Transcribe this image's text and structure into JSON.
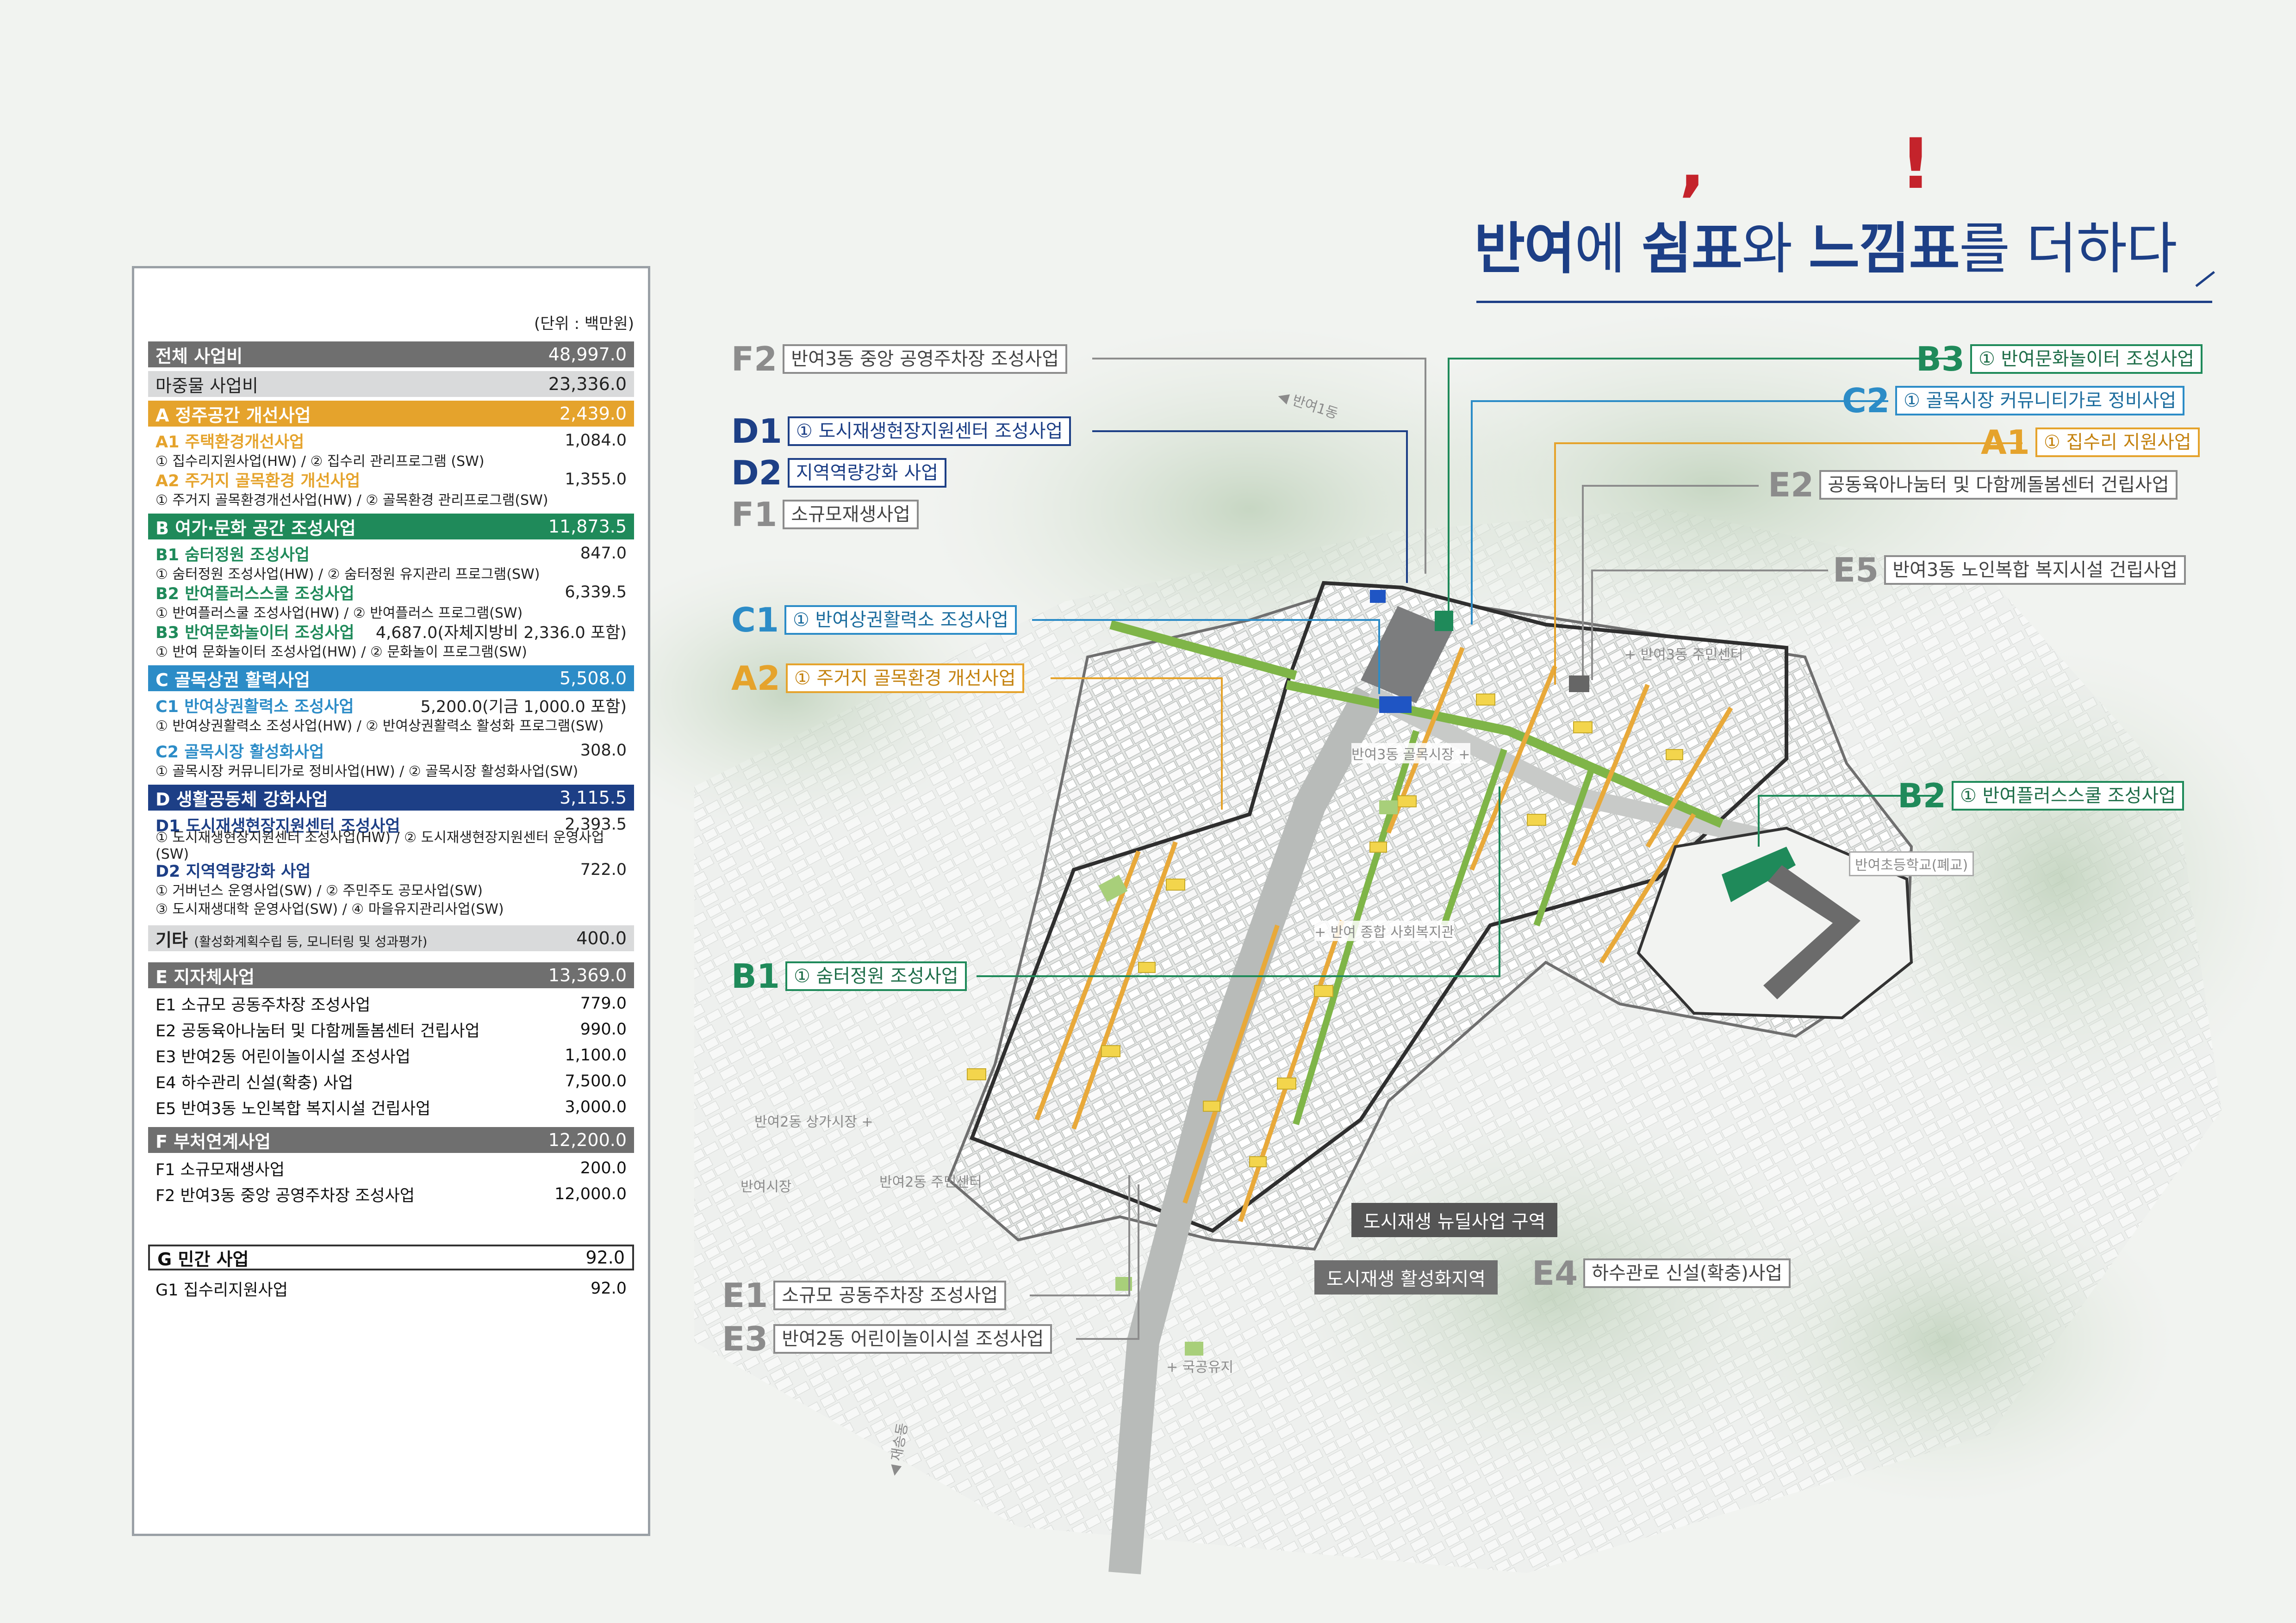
{
  "title": {
    "part1": "반여",
    "part2": "에 ",
    "part3": "쉼표",
    "part4": "와 ",
    "part5": "느낌표",
    "part6": "를 더하다",
    "comma_mark": ",",
    "exclamation_mark": "!"
  },
  "colors": {
    "navy": "#1d3f86",
    "accent_red": "#c4232b",
    "cat_a": "#e5a32c",
    "cat_b": "#1f8a5a",
    "cat_c": "#2c8cc7",
    "cat_d": "#1d3f86",
    "cat_gray": "#6f6f6f"
  },
  "budget": {
    "unit": "(단위 : 백만원)",
    "total": {
      "label": "전체 사업비",
      "value": "48,997.0"
    },
    "matching": {
      "label": "마중물 사업비",
      "value": "23,336.0"
    },
    "a": {
      "label": "A 정주공간 개선사업",
      "value": "2,439.0",
      "a1": {
        "label": "A1 주택환경개선사업",
        "value": "1,084.0",
        "detail": "① 집수리지원사업(HW) / ② 집수리 관리프로그램 (SW)"
      },
      "a2": {
        "label": "A2 주거지 골목환경 개선사업",
        "value": "1,355.0",
        "detail": "① 주거지 골목환경개선사업(HW) / ② 골목환경 관리프로그램(SW)"
      }
    },
    "b": {
      "label": "B 여가·문화 공간 조성사업",
      "value": "11,873.5",
      "b1": {
        "label": "B1 숨터정원 조성사업",
        "value": "847.0",
        "detail": "① 숨터정원 조성사업(HW) / ② 숨터정원 유지관리 프로그램(SW)"
      },
      "b2": {
        "label": "B2 반여플러스스쿨 조성사업",
        "value": "6,339.5",
        "detail": "① 반여플러스쿨 조성사업(HW) / ② 반여플러스 프로그램(SW)"
      },
      "b3": {
        "label": "B3 반여문화놀이터 조성사업",
        "value": "4,687.0(자체지방비 2,336.0 포함)",
        "detail": "① 반여 문화놀이터 조성사업(HW) / ② 문화놀이 프로그램(SW)"
      }
    },
    "c": {
      "label": "C 골목상권 활력사업",
      "value": "5,508.0",
      "c1": {
        "label": "C1 반여상권활력소 조성사업",
        "value": "5,200.0(기금 1,000.0 포함)",
        "detail": "① 반여상권활력소 조성사업(HW) / ② 반여상권활력소 활성화 프로그램(SW)"
      },
      "c2": {
        "label": "C2 골목시장 활성화사업",
        "value": "308.0",
        "detail": "① 골목시장 커뮤니티가로 정비사업(HW) / ② 골목시장 활성화사업(SW)"
      }
    },
    "d": {
      "label": "D 생활공동체 강화사업",
      "value": "3,115.5",
      "d1": {
        "label": "D1 도시재생현장지원센터 조성사업",
        "value": "2,393.5",
        "detail": "① 도시재생현장지원센터 조성사업(HW) / ② 도시재생현장지원센터 운영사업(SW)"
      },
      "d2": {
        "label": "D2 지역역량강화 사업",
        "value": "722.0",
        "detail1": "① 거버넌스 운영사업(SW) / ② 주민주도 공모사업(SW)",
        "detail2": "③ 도시재생대학 운영사업(SW) / ④ 마을유지관리사업(SW)"
      }
    },
    "etc": {
      "label": "기타",
      "note": "(활성화계획수립 등, 모니터링 및 성과평가)",
      "value": "400.0"
    },
    "e": {
      "label": "E 지자체사업",
      "value": "13,369.0",
      "items": [
        {
          "label": "E1 소규모 공동주차장 조성사업",
          "value": "779.0"
        },
        {
          "label": "E2 공동육아나눔터 및 다함께돌봄센터 건립사업",
          "value": "990.0"
        },
        {
          "label": "E3 반여2동 어린이놀이시설 조성사업",
          "value": "1,100.0"
        },
        {
          "label": "E4 하수관리 신설(확충) 사업",
          "value": "7,500.0"
        },
        {
          "label": "E5 반여3동 노인복합 복지시설 건립사업",
          "value": "3,000.0"
        }
      ]
    },
    "f": {
      "label": "F 부처연계사업",
      "value": "12,200.0",
      "items": [
        {
          "label": "F1 소규모재생사업",
          "value": "200.0"
        },
        {
          "label": "F2 반여3동 중앙 공영주차장 조성사업",
          "value": "12,000.0"
        }
      ]
    },
    "g": {
      "label": "G 민간 사업",
      "value": "92.0",
      "items": [
        {
          "label": "G1 집수리지원사업",
          "value": "92.0"
        }
      ]
    }
  },
  "map_labels": {
    "f2": {
      "code": "F2",
      "text": "반여3동 중앙 공영주차장 조성사업"
    },
    "d1": {
      "code": "D1",
      "text": "① 도시재생현장지원센터 조성사업"
    },
    "d2": {
      "code": "D2",
      "text": "지역역량강화 사업"
    },
    "f1": {
      "code": "F1",
      "text": "소규모재생사업"
    },
    "c1": {
      "code": "C1",
      "text": "① 반여상권활력소 조성사업"
    },
    "a2": {
      "code": "A2",
      "text": "① 주거지 골목환경 개선사업"
    },
    "b1": {
      "code": "B1",
      "text": "① 숨터정원 조성사업"
    },
    "b3": {
      "code": "B3",
      "text": "① 반여문화놀이터 조성사업"
    },
    "c2": {
      "code": "C2",
      "text": "① 골목시장 커뮤니티가로 정비사업"
    },
    "a1": {
      "code": "A1",
      "text": "① 집수리 지원사업"
    },
    "e2": {
      "code": "E2",
      "text": "공동육아나눔터 및 다함께돌봄센터 건립사업"
    },
    "e5": {
      "code": "E5",
      "text": "반여3동 노인복합 복지시설 건립사업"
    },
    "b2": {
      "code": "B2",
      "text": "① 반여플러스스쿨 조성사업"
    },
    "e1": {
      "code": "E1",
      "text": "소규모 공동주차장 조성사업"
    },
    "e3": {
      "code": "E3",
      "text": "반여2동 어린이놀이시설 조성사업"
    },
    "e4": {
      "code": "E4",
      "text": "하수관로 신설(확충)사업"
    }
  },
  "places": {
    "banyeo1": "◀ 반여1동",
    "center3": "+ 반여3동 주민센터",
    "market3": "반여3동 골목시장 +",
    "welfare": "+ 반여 종합 사회복지관",
    "school": "반여초등학교(폐교)",
    "mall2": "반여2동 상가시장 +",
    "market": "반여시장",
    "center2": "반여2동 주민센터",
    "park": "+ 국공유지",
    "jaesong": "◀ 재송동"
  },
  "legend": {
    "newdeal": "도시재생 뉴딜사업 구역",
    "activation": "도시재생 활성화지역"
  }
}
